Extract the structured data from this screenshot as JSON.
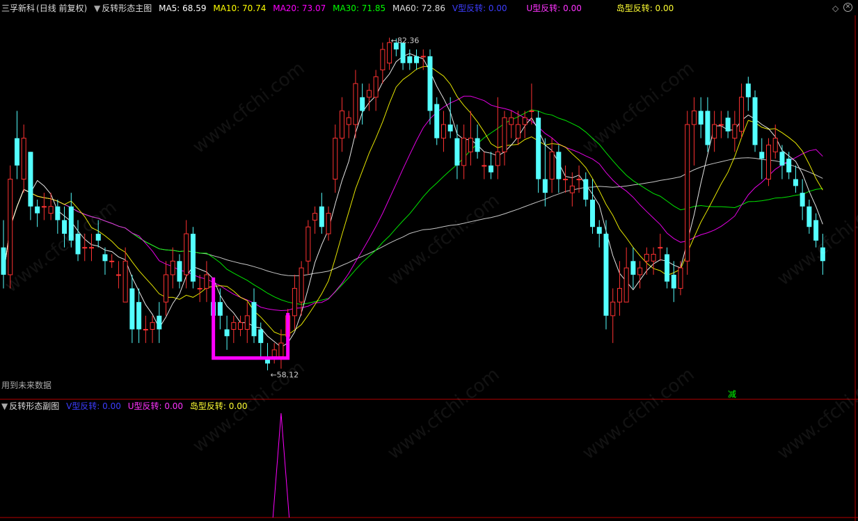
{
  "main_panel": {
    "stock_name": "三孚新科",
    "period_label": "(日线 前复权)",
    "indicator_name": "反转形态主图",
    "ma_labels": [
      {
        "text": "MA5: 68.59",
        "color": "#ffffff"
      },
      {
        "text": "MA10: 70.74",
        "color": "#ffff00"
      },
      {
        "text": "MA20: 73.07",
        "color": "#ff00ff"
      },
      {
        "text": "MA30: 71.85",
        "color": "#00ff00"
      },
      {
        "text": "MA60: 72.86",
        "color": "#dddddd"
      }
    ],
    "signal_labels": [
      {
        "text": "V型反转: 0.00",
        "color": "#3d3dff"
      },
      {
        "text": "U型反转: 0.00",
        "color": "#ff33ff"
      },
      {
        "text": "岛型反转: 0.00",
        "color": "#ffff33"
      }
    ],
    "high_label": "82.36",
    "low_label": "58.12",
    "future_data_note": "用到未来数据",
    "marker_text": "减"
  },
  "sub_panel": {
    "indicator_name": "反转形态副图",
    "signal_labels": [
      {
        "text": "V型反转: 0.00",
        "color": "#3d3dff"
      },
      {
        "text": "U型反转: 0.00",
        "color": "#ff33ff"
      },
      {
        "text": "岛型反转: 0.00",
        "color": "#ffff33"
      }
    ]
  },
  "controls": {
    "diamond_icon": "diamond-icon",
    "close_icon": "close-icon"
  },
  "watermark_text": "www.cfchi.com",
  "colors": {
    "up": "#ff3232",
    "down": "#54ffff",
    "ma5": "#ffffff",
    "ma10": "#ffff00",
    "ma20": "#ff00ff",
    "ma30": "#00ff00",
    "ma60": "#dddddd",
    "u_pattern": "#ff00ff",
    "frame": "#b40000"
  },
  "chart_data": {
    "type": "candlestick",
    "price_range": [
      57,
      84
    ],
    "candles": [
      {
        "o": 67,
        "h": 69,
        "l": 64,
        "c": 65
      },
      {
        "o": 65,
        "h": 73,
        "l": 64,
        "c": 72
      },
      {
        "o": 75,
        "h": 77,
        "l": 72,
        "c": 73
      },
      {
        "o": 72,
        "h": 76,
        "l": 71,
        "c": 75
      },
      {
        "o": 74,
        "h": 74,
        "l": 69,
        "c": 70
      },
      {
        "o": 70,
        "h": 70.5,
        "l": 68.5,
        "c": 69.5
      },
      {
        "o": 70,
        "h": 71,
        "l": 69,
        "c": 70
      },
      {
        "o": 69.5,
        "h": 71,
        "l": 69,
        "c": 70
      },
      {
        "o": 70,
        "h": 70.5,
        "l": 68,
        "c": 69
      },
      {
        "o": 69,
        "h": 70,
        "l": 67,
        "c": 68
      },
      {
        "o": 70,
        "h": 71,
        "l": 67,
        "c": 67.5
      },
      {
        "o": 68,
        "h": 69,
        "l": 66,
        "c": 66.5
      },
      {
        "o": 67,
        "h": 68,
        "l": 66,
        "c": 67
      },
      {
        "o": 67,
        "h": 68,
        "l": 66,
        "c": 67
      },
      {
        "o": 68,
        "h": 69,
        "l": 67,
        "c": 67.5
      },
      {
        "o": 66.5,
        "h": 67,
        "l": 65,
        "c": 66
      },
      {
        "o": 66,
        "h": 66.5,
        "l": 65.5,
        "c": 66
      },
      {
        "o": 65,
        "h": 66,
        "l": 64,
        "c": 65
      },
      {
        "o": 63,
        "h": 67,
        "l": 63,
        "c": 66
      },
      {
        "o": 64,
        "h": 65,
        "l": 60,
        "c": 61
      },
      {
        "o": 63,
        "h": 64,
        "l": 60,
        "c": 61
      },
      {
        "o": 61,
        "h": 62,
        "l": 60,
        "c": 61
      },
      {
        "o": 61,
        "h": 62,
        "l": 60,
        "c": 61.5
      },
      {
        "o": 62,
        "h": 63,
        "l": 60,
        "c": 61
      },
      {
        "o": 63,
        "h": 66,
        "l": 62,
        "c": 65
      },
      {
        "o": 65,
        "h": 67,
        "l": 64,
        "c": 66
      },
      {
        "o": 66,
        "h": 66.5,
        "l": 64,
        "c": 64.5
      },
      {
        "o": 65,
        "h": 69,
        "l": 64,
        "c": 68
      },
      {
        "o": 68,
        "h": 68.5,
        "l": 64,
        "c": 64.5
      },
      {
        "o": 64,
        "h": 65,
        "l": 63,
        "c": 64
      },
      {
        "o": 64,
        "h": 66,
        "l": 63,
        "c": 65
      },
      {
        "o": 63,
        "h": 64,
        "l": 62,
        "c": 62
      },
      {
        "o": 63,
        "h": 64,
        "l": 61,
        "c": 62
      },
      {
        "o": 61,
        "h": 62,
        "l": 59.5,
        "c": 60.5
      },
      {
        "o": 61,
        "h": 62,
        "l": 60,
        "c": 61.5
      },
      {
        "o": 61,
        "h": 62,
        "l": 60.5,
        "c": 61.5
      },
      {
        "o": 61,
        "h": 63,
        "l": 60,
        "c": 62
      },
      {
        "o": 63,
        "h": 64,
        "l": 60,
        "c": 60.5
      },
      {
        "o": 61,
        "h": 61.5,
        "l": 59,
        "c": 60
      },
      {
        "o": 59,
        "h": 60,
        "l": 58,
        "c": 58.5
      },
      {
        "o": 59,
        "h": 60,
        "l": 58.5,
        "c": 59.5
      },
      {
        "o": 59,
        "h": 61,
        "l": 58.12,
        "c": 60
      },
      {
        "o": 60.5,
        "h": 62.5,
        "l": 60,
        "c": 62
      },
      {
        "o": 62,
        "h": 65,
        "l": 61,
        "c": 64
      },
      {
        "o": 63,
        "h": 66,
        "l": 62,
        "c": 65.5
      },
      {
        "o": 66,
        "h": 69,
        "l": 65,
        "c": 68.5
      },
      {
        "o": 69,
        "h": 70,
        "l": 68,
        "c": 69.5
      },
      {
        "o": 70,
        "h": 71,
        "l": 68,
        "c": 68.5
      },
      {
        "o": 68,
        "h": 70,
        "l": 67.5,
        "c": 69.5
      },
      {
        "o": 72,
        "h": 76,
        "l": 71,
        "c": 75
      },
      {
        "o": 75,
        "h": 78,
        "l": 74,
        "c": 77
      },
      {
        "o": 76,
        "h": 77,
        "l": 75,
        "c": 76.5
      },
      {
        "o": 76,
        "h": 80,
        "l": 75,
        "c": 79
      },
      {
        "o": 78,
        "h": 79,
        "l": 76,
        "c": 77
      },
      {
        "o": 78,
        "h": 79,
        "l": 77,
        "c": 78.5
      },
      {
        "o": 78,
        "h": 80,
        "l": 77,
        "c": 79.5
      },
      {
        "o": 80,
        "h": 82,
        "l": 79,
        "c": 81.5
      },
      {
        "o": 80.5,
        "h": 82.36,
        "l": 80,
        "c": 82
      },
      {
        "o": 82,
        "h": 82.3,
        "l": 81,
        "c": 81.5
      },
      {
        "o": 82,
        "h": 82,
        "l": 80,
        "c": 80.5
      },
      {
        "o": 81,
        "h": 81.5,
        "l": 80,
        "c": 80.5
      },
      {
        "o": 81,
        "h": 81.5,
        "l": 80,
        "c": 80.5
      },
      {
        "o": 81,
        "h": 81.5,
        "l": 80,
        "c": 81
      },
      {
        "o": 81,
        "h": 81.5,
        "l": 76,
        "c": 77
      },
      {
        "o": 77.5,
        "h": 78,
        "l": 74.5,
        "c": 75
      },
      {
        "o": 75,
        "h": 77,
        "l": 74,
        "c": 76
      },
      {
        "o": 76,
        "h": 78,
        "l": 75,
        "c": 75.5
      },
      {
        "o": 75,
        "h": 76,
        "l": 72,
        "c": 73
      },
      {
        "o": 73,
        "h": 76,
        "l": 72,
        "c": 75
      },
      {
        "o": 74,
        "h": 77,
        "l": 73,
        "c": 75
      },
      {
        "o": 75,
        "h": 76,
        "l": 73.5,
        "c": 74
      },
      {
        "o": 73,
        "h": 74,
        "l": 72,
        "c": 73
      },
      {
        "o": 73,
        "h": 74,
        "l": 72,
        "c": 72.5
      },
      {
        "o": 73,
        "h": 78,
        "l": 72,
        "c": 74
      },
      {
        "o": 74,
        "h": 77,
        "l": 73,
        "c": 76.5
      },
      {
        "o": 76,
        "h": 77,
        "l": 75,
        "c": 76.5
      },
      {
        "o": 75,
        "h": 77,
        "l": 74.5,
        "c": 76
      },
      {
        "o": 76,
        "h": 77,
        "l": 75,
        "c": 76.5
      },
      {
        "o": 77,
        "h": 79,
        "l": 76,
        "c": 77
      },
      {
        "o": 76.5,
        "h": 77,
        "l": 71,
        "c": 72
      },
      {
        "o": 72,
        "h": 75,
        "l": 70,
        "c": 71
      },
      {
        "o": 72,
        "h": 75,
        "l": 71,
        "c": 74
      },
      {
        "o": 74,
        "h": 74.5,
        "l": 71,
        "c": 72
      },
      {
        "o": 72,
        "h": 73,
        "l": 71,
        "c": 72
      },
      {
        "o": 71,
        "h": 72.5,
        "l": 70,
        "c": 71.5
      },
      {
        "o": 72,
        "h": 73,
        "l": 71,
        "c": 72
      },
      {
        "o": 72,
        "h": 72.5,
        "l": 70,
        "c": 70.5
      },
      {
        "o": 70.5,
        "h": 72,
        "l": 68,
        "c": 68.5
      },
      {
        "o": 68.5,
        "h": 69,
        "l": 67,
        "c": 68
      },
      {
        "o": 68,
        "h": 69,
        "l": 61,
        "c": 62
      },
      {
        "o": 62,
        "h": 64,
        "l": 60,
        "c": 63
      },
      {
        "o": 63,
        "h": 66,
        "l": 62,
        "c": 64
      },
      {
        "o": 63,
        "h": 67,
        "l": 63,
        "c": 65.5
      },
      {
        "o": 66,
        "h": 67,
        "l": 64,
        "c": 65
      },
      {
        "o": 65,
        "h": 66,
        "l": 64,
        "c": 65.5
      },
      {
        "o": 66,
        "h": 67,
        "l": 65,
        "c": 66.5
      },
      {
        "o": 66,
        "h": 67,
        "l": 65,
        "c": 66.5
      },
      {
        "o": 67,
        "h": 68,
        "l": 66,
        "c": 67
      },
      {
        "o": 66.5,
        "h": 67,
        "l": 64,
        "c": 64.5
      },
      {
        "o": 65,
        "h": 66,
        "l": 63,
        "c": 64
      },
      {
        "o": 64,
        "h": 66,
        "l": 63.5,
        "c": 65.5
      },
      {
        "o": 66,
        "h": 77,
        "l": 65,
        "c": 76
      },
      {
        "o": 76,
        "h": 78,
        "l": 73,
        "c": 77
      },
      {
        "o": 77,
        "h": 78,
        "l": 75,
        "c": 76
      },
      {
        "o": 77,
        "h": 78,
        "l": 74,
        "c": 74.5
      },
      {
        "o": 75,
        "h": 77,
        "l": 74,
        "c": 76
      },
      {
        "o": 76,
        "h": 77,
        "l": 75,
        "c": 76
      },
      {
        "o": 76.5,
        "h": 77,
        "l": 75,
        "c": 75.5
      },
      {
        "o": 75,
        "h": 77,
        "l": 74,
        "c": 76
      },
      {
        "o": 75.5,
        "h": 79,
        "l": 75,
        "c": 78
      },
      {
        "o": 79,
        "h": 79.5,
        "l": 77,
        "c": 78
      },
      {
        "o": 78,
        "h": 78.5,
        "l": 74,
        "c": 74.5
      },
      {
        "o": 74,
        "h": 75,
        "l": 72,
        "c": 73.5
      },
      {
        "o": 72,
        "h": 75,
        "l": 71.5,
        "c": 74.5
      },
      {
        "o": 74,
        "h": 76,
        "l": 73.5,
        "c": 75
      },
      {
        "o": 74,
        "h": 74.5,
        "l": 72,
        "c": 73
      },
      {
        "o": 73.5,
        "h": 74,
        "l": 72,
        "c": 72.5
      },
      {
        "o": 72,
        "h": 73,
        "l": 71,
        "c": 71.5
      },
      {
        "o": 71,
        "h": 72,
        "l": 69,
        "c": 70
      },
      {
        "o": 70,
        "h": 70.5,
        "l": 68,
        "c": 68.5
      },
      {
        "o": 69,
        "h": 69.5,
        "l": 67,
        "c": 67.5
      },
      {
        "o": 67,
        "h": 68,
        "l": 65,
        "c": 66
      }
    ],
    "indicator": {
      "type": "line",
      "peak_index": 41,
      "peak_value": 1
    }
  }
}
